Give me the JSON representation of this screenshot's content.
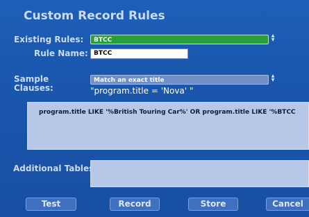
{
  "title": "Custom Record Rules",
  "existing_rules": {
    "label": "Existing Rules:",
    "value": "BTCC"
  },
  "rule_name": {
    "label": "Rule Name:",
    "value": "BTCC"
  },
  "sample_clauses": {
    "label_line1": "Sample",
    "label_line2": "Clauses:",
    "value": "Match an exact title",
    "example": "\"program.title = 'Nova' \""
  },
  "clause_text": "program.title LIKE '%British Touring Car%' OR program.title LIKE '%BTCC",
  "additional_tables": {
    "label": "Additional Tables:",
    "value": ""
  },
  "buttons": {
    "test": "Test",
    "record": "Record",
    "store": "Store",
    "cancel": "Cancel"
  }
}
